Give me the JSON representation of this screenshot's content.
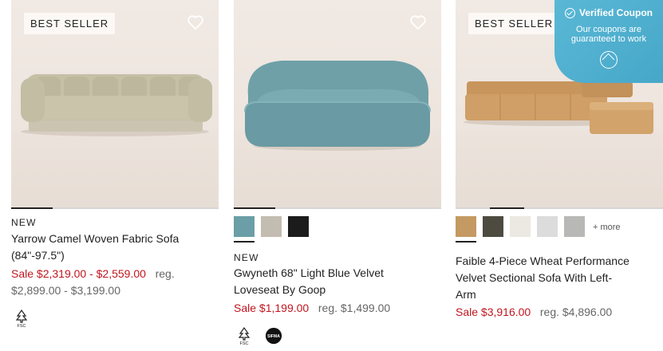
{
  "products": [
    {
      "badge": "BEST SELLER",
      "tag": "NEW",
      "title_line1": "Yarrow Camel Woven Fabric Sofa",
      "title_line2": "(84\"-97.5\")",
      "sale_price": "Sale $2,319.00 - $2,559.00",
      "reg_label": "reg.",
      "reg_price": "$2,899.00 - $3,199.00",
      "certifications": [
        "FSC"
      ],
      "image_alt": "beige channel-tufted sofa",
      "carousel_position": 0.2
    },
    {
      "badge": "",
      "tag": "NEW",
      "title_line1": "Gwyneth 68\" Light Blue Velvet",
      "title_line2": "Loveseat By Goop",
      "sale_price": "Sale $1,199.00",
      "reg_label": "reg.",
      "reg_price": "$1,499.00",
      "swatches": [
        {
          "name": "light blue",
          "color": "#6b9ea6"
        },
        {
          "name": "taupe",
          "color": "#c3bcb1"
        },
        {
          "name": "black",
          "color": "#1b1b1b"
        }
      ],
      "certifications": [
        "FSC",
        "SIFMA"
      ],
      "image_alt": "light blue velvet loveseat",
      "carousel_position": 0.2
    },
    {
      "badge": "BEST SELLER",
      "tag": "",
      "title_line1": "Faible 4-Piece Wheat Performance",
      "title_line2": "Velvet Sectional Sofa With Left-",
      "title_line3": "Arm",
      "sale_price": "Sale $3,916.00",
      "reg_label": "reg.",
      "reg_price": "$4,896.00",
      "swatches": [
        {
          "name": "wheat",
          "color": "#c49a62"
        },
        {
          "name": "olive",
          "color": "#4d4a40"
        },
        {
          "name": "ivory",
          "color": "#ece8e2"
        },
        {
          "name": "light grey",
          "color": "#dcdcdc"
        },
        {
          "name": "grey",
          "color": "#b8b8b6"
        }
      ],
      "more_swatches": "+ more",
      "image_alt": "wheat velvet sectional sofa",
      "carousel_position": 0.3
    }
  ],
  "coupon": {
    "title": "Verified Coupon",
    "subtitle_line1": "Our coupons are",
    "subtitle_line2": "guaranteed to work",
    "icon": "home-icon"
  },
  "colors": {
    "sale": "#c0161f",
    "coupon": "#4fb0cf"
  }
}
